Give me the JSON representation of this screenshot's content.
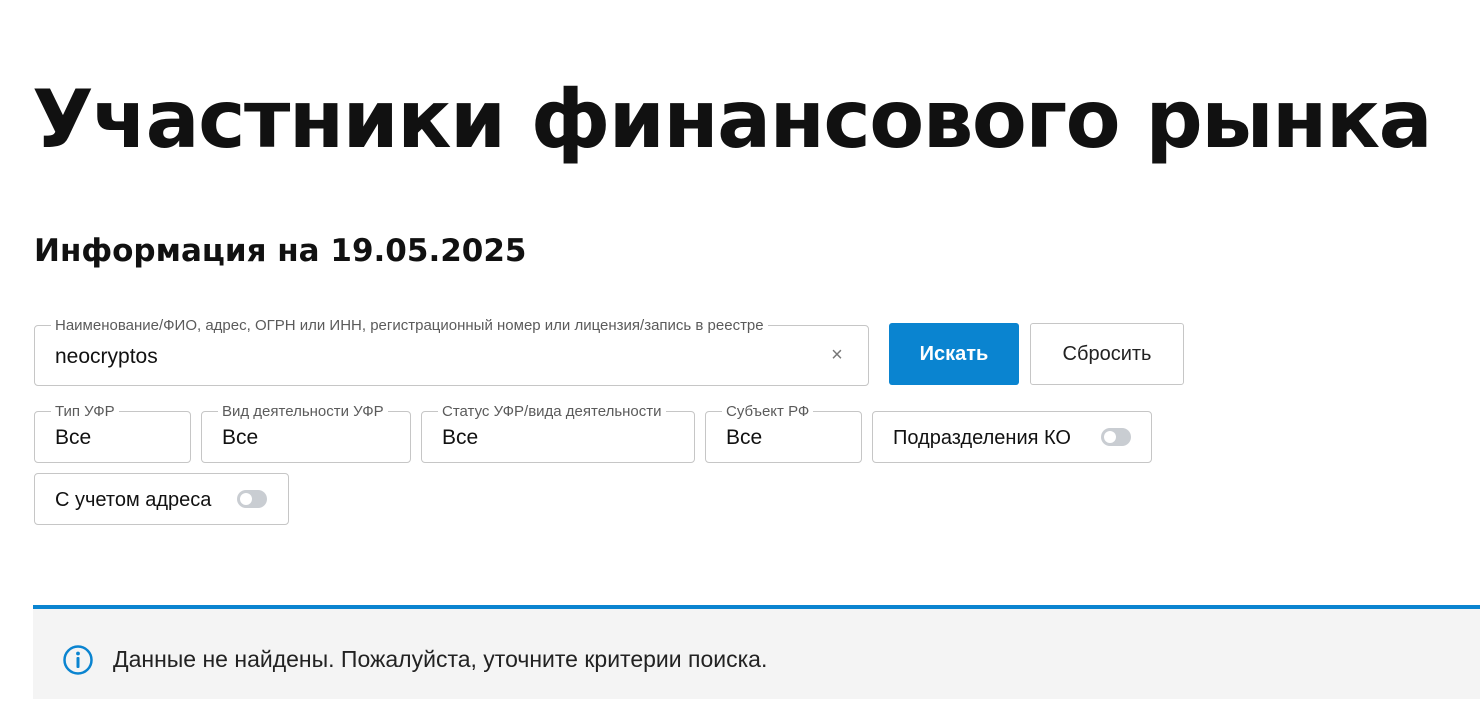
{
  "page": {
    "title": "Участники финансового рынка",
    "info_date": "Информация на 19.05.2025"
  },
  "search": {
    "label": "Наименование/ФИО, адрес, ОГРН или ИНН, регистрационный номер или лицензия/запись в реестре",
    "value": "neocryptos",
    "clear_icon": "×",
    "search_button": "Искать",
    "reset_button": "Сбросить"
  },
  "filters": {
    "type": {
      "label": "Тип УФР",
      "value": "Все"
    },
    "activity": {
      "label": "Вид деятельности УФР",
      "value": "Все"
    },
    "status": {
      "label": "Статус УФР/вида деятельности",
      "value": "Все"
    },
    "region": {
      "label": "Субъект РФ",
      "value": "Все"
    }
  },
  "toggles": {
    "branches": {
      "label": "Подразделения КО",
      "on": false
    },
    "address": {
      "label": "С учетом адреса",
      "on": false
    }
  },
  "notice": {
    "icon": "info-icon",
    "text": "Данные не найдены. Пожалуйста, уточните критерии поиска."
  },
  "colors": {
    "accent": "#0a84d0",
    "notice_bg": "#f4f4f4",
    "border": "#c6c6c6",
    "toggle_off": "#c9cdd2"
  }
}
